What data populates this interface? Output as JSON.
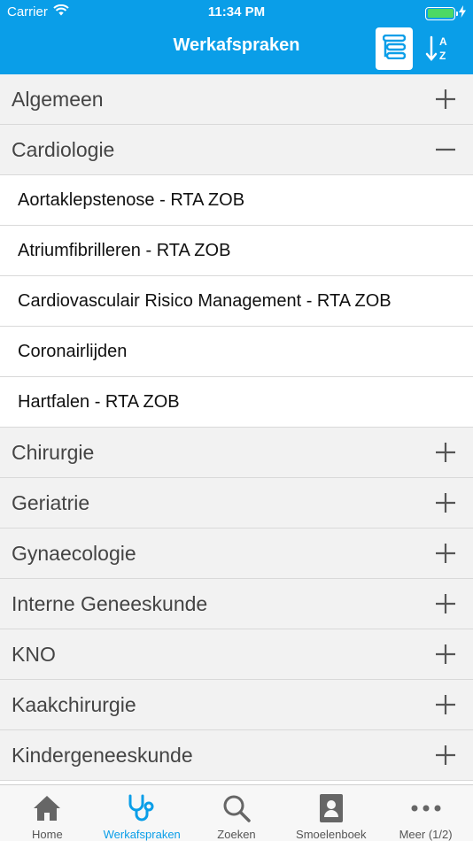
{
  "status": {
    "carrier": "Carrier",
    "time": "11:34 PM"
  },
  "nav": {
    "title": "Werkafspraken",
    "sort_letters": [
      "A",
      "Z"
    ]
  },
  "categories": [
    {
      "label": "Algemeen",
      "expanded": false,
      "items": []
    },
    {
      "label": "Cardiologie",
      "expanded": true,
      "items": [
        "Aortaklepstenose - RTA ZOB",
        "Atriumfibrilleren - RTA ZOB",
        "Cardiovasculair Risico Management - RTA ZOB",
        "Coronairlijden",
        "Hartfalen - RTA ZOB"
      ]
    },
    {
      "label": "Chirurgie",
      "expanded": false,
      "items": []
    },
    {
      "label": "Geriatrie",
      "expanded": false,
      "items": []
    },
    {
      "label": "Gynaecologie",
      "expanded": false,
      "items": []
    },
    {
      "label": "Interne Geneeskunde",
      "expanded": false,
      "items": []
    },
    {
      "label": "KNO",
      "expanded": false,
      "items": []
    },
    {
      "label": "Kaakchirurgie",
      "expanded": false,
      "items": []
    },
    {
      "label": "Kindergeneeskunde",
      "expanded": false,
      "items": []
    }
  ],
  "tabs": [
    {
      "label": "Home",
      "icon": "home-icon",
      "active": false
    },
    {
      "label": "Werkafspraken",
      "icon": "stethoscope-icon",
      "active": true
    },
    {
      "label": "Zoeken",
      "icon": "search-icon",
      "active": false
    },
    {
      "label": "Smoelenboek",
      "icon": "contact-book-icon",
      "active": false
    },
    {
      "label": "Meer (1/2)",
      "icon": "more-dots-icon",
      "active": false
    }
  ],
  "colors": {
    "accent": "#0a9ee8",
    "category_bg": "#f2f2f2",
    "battery": "#4cd964"
  }
}
